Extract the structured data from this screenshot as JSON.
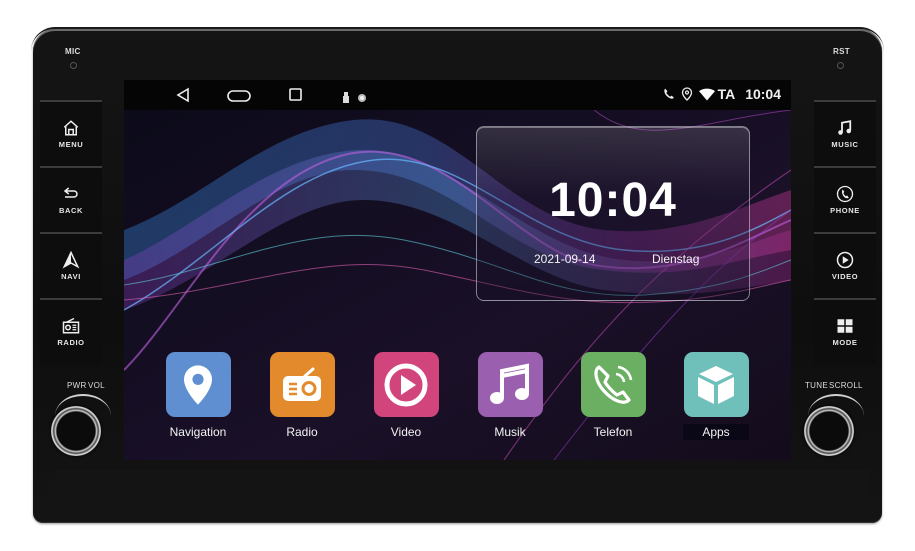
{
  "device": {
    "left_top_label": "MIC",
    "right_top_label": "RST",
    "left_knob_labels": [
      "PWR",
      "VOL"
    ],
    "right_knob_labels": [
      "TUNE",
      "SCROLL"
    ],
    "left_buttons": [
      {
        "label": "MENU",
        "icon": "home-icon"
      },
      {
        "label": "BACK",
        "icon": "back-arrow-icon"
      },
      {
        "label": "NAVI",
        "icon": "navigation-arrow-icon"
      },
      {
        "label": "RADIO",
        "icon": "radio-icon"
      }
    ],
    "right_buttons": [
      {
        "label": "MUSIC",
        "icon": "music-note-icon"
      },
      {
        "label": "PHONE",
        "icon": "phone-icon"
      },
      {
        "label": "VIDEO",
        "icon": "play-circle-icon"
      },
      {
        "label": "MODE",
        "icon": "grid-icon"
      }
    ]
  },
  "statusbar": {
    "nav": [
      "back-triangle-icon",
      "home-pill-icon",
      "recents-square-icon"
    ],
    "notifications": [
      "usb-icon",
      "record-dot-icon"
    ],
    "indicators": [
      "phone-icon",
      "location-icon",
      "wifi-icon"
    ],
    "ta_label": "TA",
    "time": "10:04"
  },
  "clock_widget": {
    "time": "10:04",
    "date": "2021-09-14",
    "weekday": "Dienstag"
  },
  "apps": [
    {
      "label": "Navigation",
      "icon": "map-pin-icon",
      "color": "#5f8fd0"
    },
    {
      "label": "Radio",
      "icon": "radio-icon",
      "color": "#e28a2c"
    },
    {
      "label": "Video",
      "icon": "play-circle-icon",
      "color": "#d2447c"
    },
    {
      "label": "Musik",
      "icon": "music-note-icon",
      "color": "#9b5fb0"
    },
    {
      "label": "Telefon",
      "icon": "phone-call-icon",
      "color": "#6bb062"
    },
    {
      "label": "Apps",
      "icon": "cube-icon",
      "color": "#6fc0ba",
      "selected": true
    }
  ]
}
